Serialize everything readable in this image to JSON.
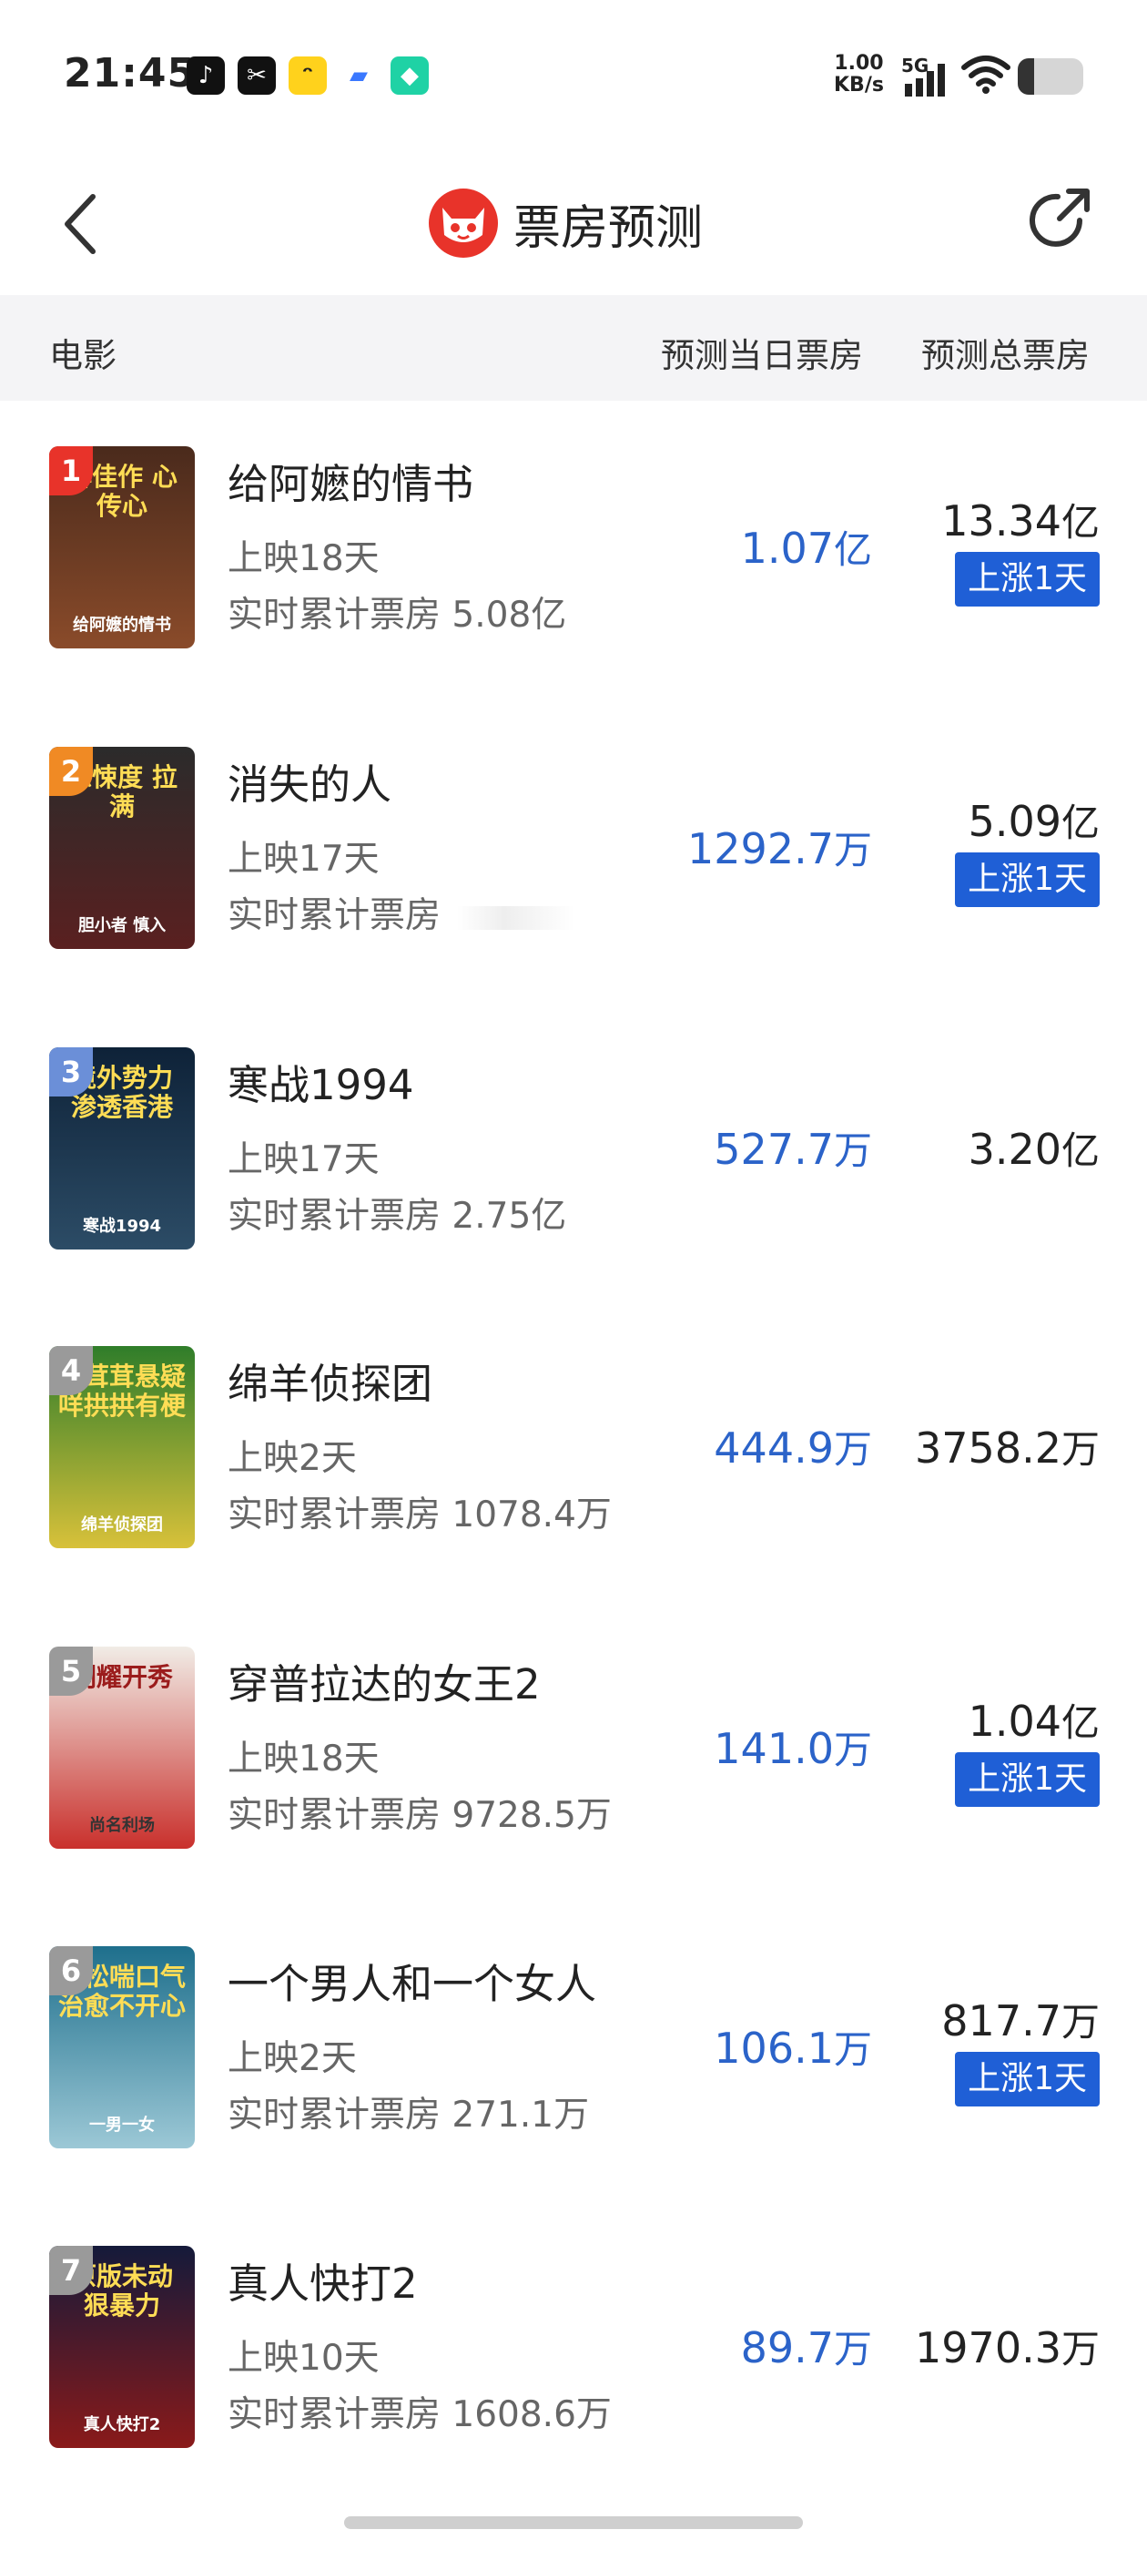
{
  "status_bar": {
    "time": "21:45",
    "net_speed_value": "1.00",
    "net_speed_unit": "KB/s",
    "network": "5G",
    "battery_level": 0.25,
    "app_icons": [
      "tiktok-icon",
      "capcut-icon",
      "bunny-icon",
      "chat-icon",
      "cube-icon"
    ]
  },
  "header": {
    "title": "票房预测",
    "accent_color": "#e8332a"
  },
  "table_header": {
    "movie": "电影",
    "daily": "预测当日票房",
    "total": "预测总票房"
  },
  "rise_color": "#1f5fd6",
  "daily_color": "#2b63c9",
  "movies": [
    {
      "rank": "1",
      "rank_color": "#e8332a",
      "title": "给阿嬷的情书",
      "days": "上映18天",
      "cum_label": "实时累计票房",
      "cum_value": "5.08亿",
      "daily_num": "1.07",
      "daily_unit": "亿",
      "total_num": "13.34",
      "total_unit": "亿",
      "badge": "上涨1天",
      "poster_top": "牌佳作 心传心",
      "poster_bottom": "给阿嬷的情书",
      "poster_colors": [
        "#4a2a1c",
        "#8a4b2a"
      ]
    },
    {
      "rank": "2",
      "rank_color": "#f08a24",
      "title": "消失的人",
      "days": "上映17天",
      "cum_label": "实时累计票房",
      "cum_value": "",
      "daily_num": "1292.7",
      "daily_unit": "万",
      "total_num": "5.09",
      "total_unit": "亿",
      "badge": "上涨1天",
      "poster_top": "惊悚度 拉满",
      "poster_bottom": "胆小者 慎入",
      "poster_colors": [
        "#2b2b2b",
        "#5a2020"
      ]
    },
    {
      "rank": "3",
      "rank_color": "#6b8fd8",
      "title": "寒战1994",
      "days": "上映17天",
      "cum_label": "实时累计票房",
      "cum_value": "2.75亿",
      "daily_num": "527.7",
      "daily_unit": "万",
      "total_num": "3.20",
      "total_unit": "亿",
      "badge": "",
      "poster_top": "境外势力 渗透香港",
      "poster_bottom": "寒战1994",
      "poster_colors": [
        "#0e2238",
        "#2c4c66"
      ]
    },
    {
      "rank": "4",
      "rank_color": "#9a9a9a",
      "title": "绵羊侦探团",
      "days": "上映2天",
      "cum_label": "实时累计票房",
      "cum_value": "1078.4万",
      "daily_num": "444.9",
      "daily_unit": "万",
      "total_num": "3758.2",
      "total_unit": "万",
      "badge": "",
      "poster_top": "毛茸茸悬疑 咩拱拱有梗",
      "poster_bottom": "绵羊侦探团",
      "poster_colors": [
        "#2f7d2a",
        "#d8c13a"
      ]
    },
    {
      "rank": "5",
      "rank_color": "#9a9a9a",
      "title": "穿普拉达的女王2",
      "days": "上映18天",
      "cum_label": "实时累计票房",
      "cum_value": "9728.5万",
      "daily_num": "141.0",
      "daily_unit": "万",
      "total_num": "1.04",
      "total_unit": "亿",
      "badge": "上涨1天",
      "poster_top": "闪耀开秀",
      "poster_bottom": "尚名利场",
      "poster_colors": [
        "#f1ece6",
        "#c9302c"
      ]
    },
    {
      "rank": "6",
      "rank_color": "#9a9a9a",
      "title": "一个男人和一个女人",
      "days": "上映2天",
      "cum_label": "实时累计票房",
      "cum_value": "271.1万",
      "daily_num": "106.1",
      "daily_unit": "万",
      "total_num": "817.7",
      "total_unit": "万",
      "badge": "上涨1天",
      "poster_top": "放松喘口气 治愈不开心",
      "poster_bottom": "一男一女",
      "poster_colors": [
        "#1e6f8c",
        "#9cc8d6"
      ]
    },
    {
      "rank": "7",
      "rank_color": "#9a9a9a",
      "title": "真人快打2",
      "days": "上映10天",
      "cum_label": "实时累计票房",
      "cum_value": "1608.6万",
      "daily_num": "89.7",
      "daily_unit": "万",
      "total_num": "1970.3",
      "total_unit": "万",
      "badge": "",
      "poster_top": "原版未动 狠暴力",
      "poster_bottom": "真人快打2",
      "poster_colors": [
        "#141a3a",
        "#8a1a1a"
      ]
    }
  ]
}
